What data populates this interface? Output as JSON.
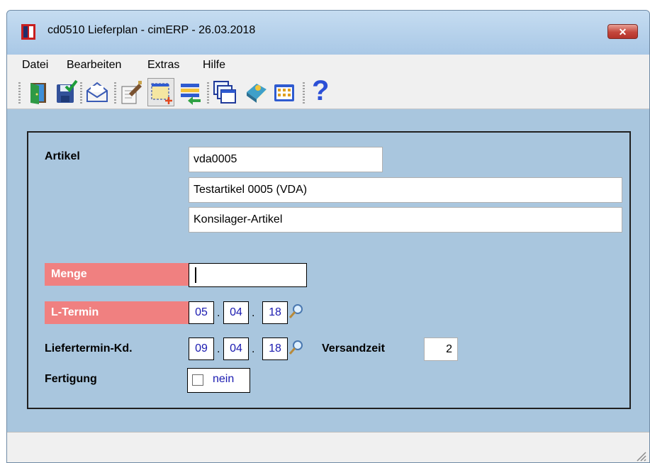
{
  "window": {
    "title": "cd0510 Lieferplan - cimERP - 26.03.2018",
    "close_symbol": "✕"
  },
  "menu": [
    "Datei",
    "Bearbeiten",
    "Extras",
    "Hilfe"
  ],
  "toolbar": {
    "icons": [
      "exit-door-icon",
      "save-check-icon",
      "mail-envelope-icon",
      "edit-document-icon",
      "new-record-icon",
      "list-transfer-icon",
      "windows-stack-icon",
      "book-icon",
      "calendar-grid-icon",
      "help-icon"
    ],
    "help_symbol": "?"
  },
  "form": {
    "artikel_label": "Artikel",
    "artikel_nr": "vda0005",
    "artikel_bez1": "Testartikel 0005 (VDA)",
    "artikel_bez2": "Konsilager-Artikel",
    "menge_label": "Menge",
    "menge_value": "",
    "ltermin_label": "L-Termin",
    "ltermin": {
      "day": "05",
      "month": "04",
      "year": "18"
    },
    "liefertermin_label": "Liefertermin-Kd.",
    "liefertermin": {
      "day": "09",
      "month": "04",
      "year": "18"
    },
    "date_sep": ".",
    "versandzeit_label": "Versandzeit",
    "versandzeit_value": "2",
    "fertigung_label": "Fertigung",
    "fertigung_checked": false,
    "fertigung_text": "nein"
  },
  "colors": {
    "required_label_bg": "#f08080",
    "panel_bg": "#a9c6de",
    "date_text": "#1a1ab0"
  }
}
